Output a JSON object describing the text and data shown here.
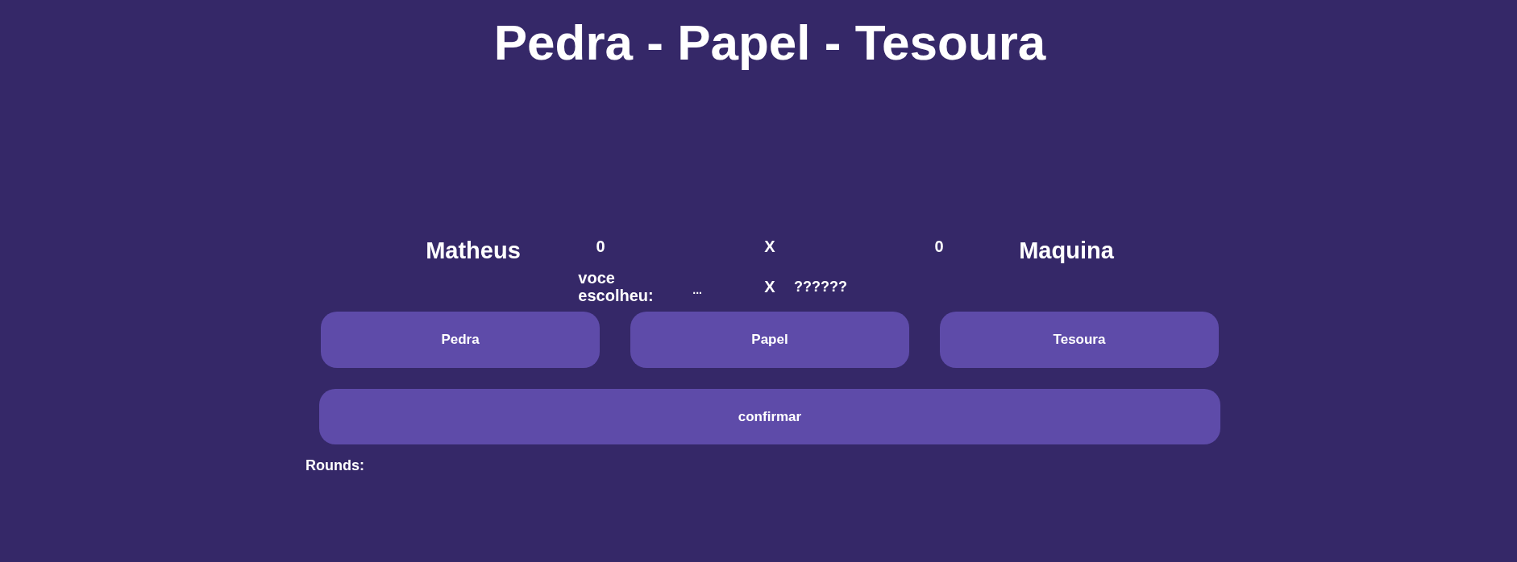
{
  "title": "Pedra - Papel - Tesoura",
  "scoreboard": {
    "player_name": "Matheus",
    "player_score": "0",
    "separator": "X",
    "machine_score": "0",
    "machine_name": "Maquina"
  },
  "choice_row": {
    "label": "voce escolheu:",
    "player_choice": "...",
    "separator": "X",
    "machine_choice": "??????"
  },
  "choice_buttons": [
    {
      "label": "Pedra",
      "selected": false
    },
    {
      "label": "Papel",
      "selected": false
    },
    {
      "label": "Tesoura",
      "selected": false
    }
  ],
  "confirm_button": {
    "label": "confirmar"
  },
  "rounds": {
    "label": "Rounds:"
  }
}
